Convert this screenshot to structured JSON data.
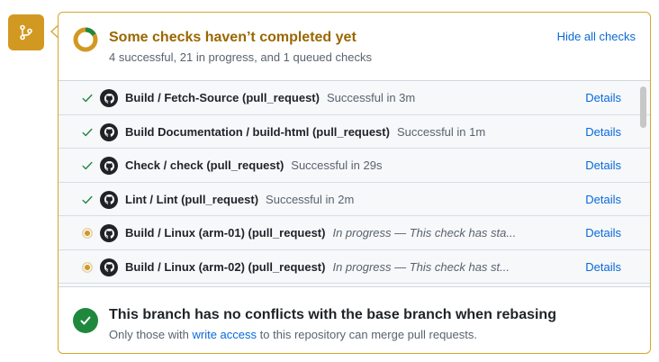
{
  "header": {
    "title": "Some checks haven’t completed yet",
    "subtitle": "4 successful, 21 in progress, and 1 queued checks",
    "hide_checks": "Hide all checks"
  },
  "checks": [
    {
      "status": "success",
      "name": "Build / Fetch-Source (pull_request)",
      "description": "Successful in 3m",
      "details": "Details"
    },
    {
      "status": "success",
      "name": "Build Documentation / build-html (pull_request)",
      "description": "Successful in 1m",
      "details": "Details"
    },
    {
      "status": "success",
      "name": "Check / check (pull_request)",
      "description": "Successful in 29s",
      "details": "Details"
    },
    {
      "status": "success",
      "name": "Lint / Lint (pull_request)",
      "description": "Successful in 2m",
      "details": "Details"
    },
    {
      "status": "in_progress",
      "name": "Build / Linux (arm-01) (pull_request)",
      "description": "In progress — This check has sta...",
      "details": "Details"
    },
    {
      "status": "in_progress",
      "name": "Build / Linux (arm-02) (pull_request)",
      "description": "In progress — This check has st...",
      "details": "Details"
    }
  ],
  "merge": {
    "title": "This branch has no conflicts with the base branch when rebasing",
    "sub_before": "Only those with ",
    "sub_link": "write access",
    "sub_after": " to this repository can merge pull requests."
  },
  "colors": {
    "pending": "#d29922",
    "success": "#1f883d",
    "link": "#0969da"
  },
  "icons": {
    "badge": "git-branch-icon",
    "success": "check-icon",
    "in_progress": "dot-icon",
    "app": "github-icon",
    "merge_ok": "check-circle-icon"
  }
}
